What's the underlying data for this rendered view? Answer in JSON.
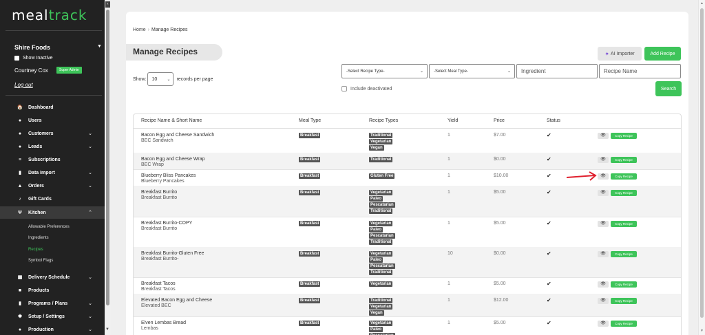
{
  "app": {
    "logo_part1": "meal",
    "logo_part2": "track"
  },
  "account": {
    "name": "Shire Foods",
    "caret": "▼",
    "show_inactive": "Show Inactive",
    "user": "Courtney Cox",
    "role": "Super Admin",
    "logout": "Log out"
  },
  "nav": {
    "items": [
      {
        "label": "Dashboard",
        "icon": "home-icon",
        "glyph": "🏠"
      },
      {
        "label": "Users",
        "icon": "user-icon",
        "glyph": "●"
      },
      {
        "label": "Customers",
        "icon": "customers-icon",
        "glyph": "●"
      },
      {
        "label": "Leads",
        "icon": "leads-icon",
        "glyph": "●"
      },
      {
        "label": "Subscriptions",
        "icon": "subscriptions-icon",
        "glyph": "≡"
      },
      {
        "label": "Data Import",
        "icon": "file-icon",
        "glyph": "▮"
      },
      {
        "label": "Orders",
        "icon": "bag-icon",
        "glyph": "▲"
      },
      {
        "label": "Gift Cards",
        "icon": "gift-icon",
        "glyph": "♪"
      },
      {
        "label": "Kitchen",
        "icon": "utensils-icon",
        "glyph": "Ψ"
      },
      {
        "label": "Delivery Schedule",
        "icon": "calendar-icon",
        "glyph": "▦"
      },
      {
        "label": "Products",
        "icon": "box-icon",
        "glyph": "■"
      },
      {
        "label": "Programs / Plans",
        "icon": "clipboard-icon",
        "glyph": "▮"
      },
      {
        "label": "Setup / Settings",
        "icon": "gear-icon",
        "glyph": "✱"
      },
      {
        "label": "Production",
        "icon": "production-icon",
        "glyph": "●"
      }
    ],
    "kitchen_sub": [
      "Allowable Preferences",
      "Ingredients",
      "Recipes",
      "Symbol Flags"
    ]
  },
  "breadcrumb": {
    "home": "Home",
    "sep": "›",
    "current": "Manage Recipes"
  },
  "page": {
    "title": "Manage Recipes"
  },
  "toolbar": {
    "ai_importer": "AI Importer",
    "add_recipe": "Add Recipe"
  },
  "filters": {
    "show_label": "Show:",
    "show_value": "10",
    "records_label": "records per page",
    "recipe_type": "-Select Recipe Type-",
    "meal_type": "-Select Meal Type-",
    "ingredient_placeholder": "Ingredient",
    "recipe_name_placeholder": "Recipe Name",
    "include_deactivated": "Include deactivated",
    "search": "Search"
  },
  "table": {
    "headers": [
      "Recipe Name & Short Name",
      "Meal Type",
      "Recipe Types",
      "Yield",
      "Price",
      "Status"
    ],
    "copy_label": "Copy Recipe",
    "rows": [
      {
        "name": "Bacon Egg and Cheese Sandwich",
        "short": "BEC Sandwich",
        "meal": "Breakfast",
        "types": [
          "Traditional",
          "Vegetarian",
          "Vegan"
        ],
        "yield": "1",
        "price": "$7.00",
        "status": "✔"
      },
      {
        "name": "Bacon Egg and Cheese Wrap",
        "short": "BEC Wrap",
        "meal": "Breakfast",
        "types": [
          "Traditional"
        ],
        "yield": "1",
        "price": "$0.00",
        "status": "✔"
      },
      {
        "name": "Blueberry Bliss Pancakes",
        "short": "Blueberry Pancakes",
        "meal": "Breakfast",
        "types": [
          "Gluten Free"
        ],
        "yield": "1",
        "price": "$10.00",
        "status": "✔"
      },
      {
        "name": "Breakfast Burrito",
        "short": "Breakfast Burrito",
        "meal": "Breakfast",
        "types": [
          "Vegetarian",
          "Paleo",
          "Pescatarian",
          "Traditional"
        ],
        "yield": "1",
        "price": "$5.00",
        "status": "✔"
      },
      {
        "name": "Breakfast Burrito-COPY",
        "short": "Breakfast Burrito",
        "meal": "Breakfast",
        "types": [
          "Vegetarian",
          "Paleo",
          "Pescatarian",
          "Traditional"
        ],
        "yield": "1",
        "price": "$5.00",
        "status": "✔"
      },
      {
        "name": "Breakfast Burrito-Gluten Free",
        "short": "Breakfast Burrito-",
        "meal": "Breakfast",
        "types": [
          "Vegetarian",
          "Paleo",
          "Pescatarian",
          "Traditional"
        ],
        "yield": "10",
        "price": "$0.00",
        "status": "✔"
      },
      {
        "name": "Breakfast Tacos",
        "short": "Breakfast Tacos",
        "meal": "Breakfast",
        "types": [
          "Vegetarian"
        ],
        "yield": "1",
        "price": "$5.00",
        "status": "✔"
      },
      {
        "name": "Elevated Bacon Egg and Cheese",
        "short": "Elevated BEC",
        "meal": "Breakfast",
        "types": [
          "Traditional",
          "Vegetarian",
          "Vegan"
        ],
        "yield": "1",
        "price": "$12.00",
        "status": "✔"
      },
      {
        "name": "Elven Lembas Bread",
        "short": "Lembas",
        "meal": "Breakfast",
        "types": [
          "Vegetarian",
          "Paleo",
          "Pescatarian"
        ],
        "yield": "1",
        "price": "$5.00",
        "status": "✔"
      }
    ]
  },
  "colors": {
    "accent": "#3ec45a",
    "sidebar": "#222222",
    "tag": "#555555",
    "annotation_arrow": "#e01f2d"
  }
}
